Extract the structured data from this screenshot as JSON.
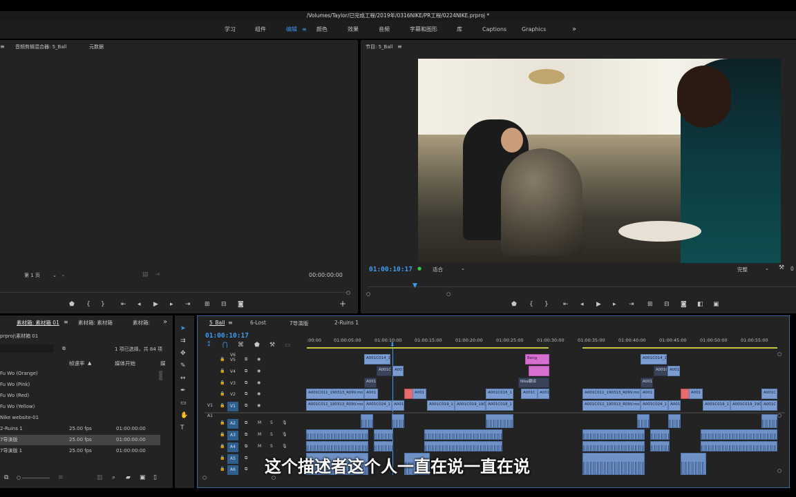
{
  "window": {
    "title": "/Volumes/Taylor/已完成工程/2019年/0316NIKE/PR工程/0224NIKE.prproj *"
  },
  "workspaces": [
    "学习",
    "组件",
    "编辑",
    "颜色",
    "效果",
    "音频",
    "字幕和图形",
    "库",
    "Captions",
    "Graphics"
  ],
  "workspace_active": "编辑",
  "source_panel": {
    "tabs": [
      "音频剪辑混合器: 5_Ball",
      "元数据"
    ],
    "page_select": "第 1 页",
    "timecode": "00:00:00:00"
  },
  "program_panel": {
    "tab": "节目: 5_Ball",
    "timecode": "01:00:10:17",
    "fit": "适合",
    "quality": "完整",
    "extra": "0"
  },
  "project_panel": {
    "tabs": [
      "素材箱: 素材箱 01",
      "素材箱: 素材箱",
      "素材箱:"
    ],
    "path": "prproj\\素材箱 01",
    "selection_info": "1 项已选择，共 84 项",
    "columns": {
      "rate": "帧速率",
      "start": "媒体开始",
      "extra": "媒"
    },
    "rows": [
      {
        "name": "Fu Wo (Orange)",
        "rate": "",
        "start": ""
      },
      {
        "name": "Fu Wo (Pink)",
        "rate": "",
        "start": ""
      },
      {
        "name": "Fu Wo (Red)",
        "rate": "",
        "start": ""
      },
      {
        "name": "Fu Wo (Yellow)",
        "rate": "",
        "start": ""
      },
      {
        "name": "Nike website-01",
        "rate": "",
        "start": ""
      },
      {
        "name": "2-Ruins 1",
        "rate": "25.00 fps",
        "start": "01:00:00:00"
      },
      {
        "name": "7导演版",
        "rate": "25.00 fps",
        "start": "01:00:00:00"
      },
      {
        "name": "7导演版 1",
        "rate": "25.00 fps",
        "start": "01:00:00:00"
      }
    ]
  },
  "timeline": {
    "tabs": [
      "5_Ball",
      "6-Lost",
      "7导演版",
      "2-Ruins 1"
    ],
    "timecode": "01:00:10:17",
    "ruler": [
      ":00:00",
      "01:00:05:00",
      "01:00:10:00",
      "01:00:15:00",
      "01:00:20:00",
      "01:00:25:00",
      "01:00:30:00",
      "01:00:35:00",
      "01:00:40:00",
      "01:00:45:00",
      "01:00:50:00",
      "01:00:55:00"
    ],
    "video_tracks": [
      "V6",
      "V5",
      "V4",
      "V3",
      "V2",
      "V1"
    ],
    "audio_tracks": [
      "A1",
      "A2",
      "A3",
      "A4",
      "A5",
      "A6"
    ],
    "audio_buttons": {
      "mute": "M",
      "solo": "S"
    },
    "clips": {
      "v5_a": "A001C014_1",
      "v5_b": "Beng",
      "v5_c": "A001C014_1",
      "v4_a": "A001C",
      "v4_b": "A001",
      "v4_c": "A001C",
      "v4_d": "A001",
      "v3_a": "A001",
      "v3_b": "Nike翻译",
      "v3_c": "A001",
      "v2_a": "A001C011_190313_R09V.mo",
      "v2_b": "A001",
      "v2_c": "A001",
      "v2_d": "A001C016_1",
      "v2_e": "A001C",
      "v2_f": "A001",
      "v2_g": "A001C011_190313_R09V.mo",
      "v2_h": "A001",
      "v2_i": "A001",
      "v2_j": "A001C",
      "v1_a": "A001C011_190313_R09V.mo",
      "v1_b": "A001C024_1",
      "v1_c": "A001",
      "v1_d": "A001C019_1",
      "v1_e": "A001C019_190",
      "v1_f": "A001C018_1",
      "v1_g": "A001C011_190313_R09V.mo",
      "v1_h": "A001C024_1",
      "v1_i": "A001",
      "v1_j": "A001C019_1",
      "v1_k": "A001C019_190",
      "v1_l": "A001C"
    }
  },
  "subtitle": "这个描述者这个人一直在说一直在说",
  "colors": {
    "accent": "#3a93e8",
    "clip_blue": "#7c9dd1",
    "clip_pink": "#d66fd0",
    "playhead": "#3c9bf2"
  }
}
